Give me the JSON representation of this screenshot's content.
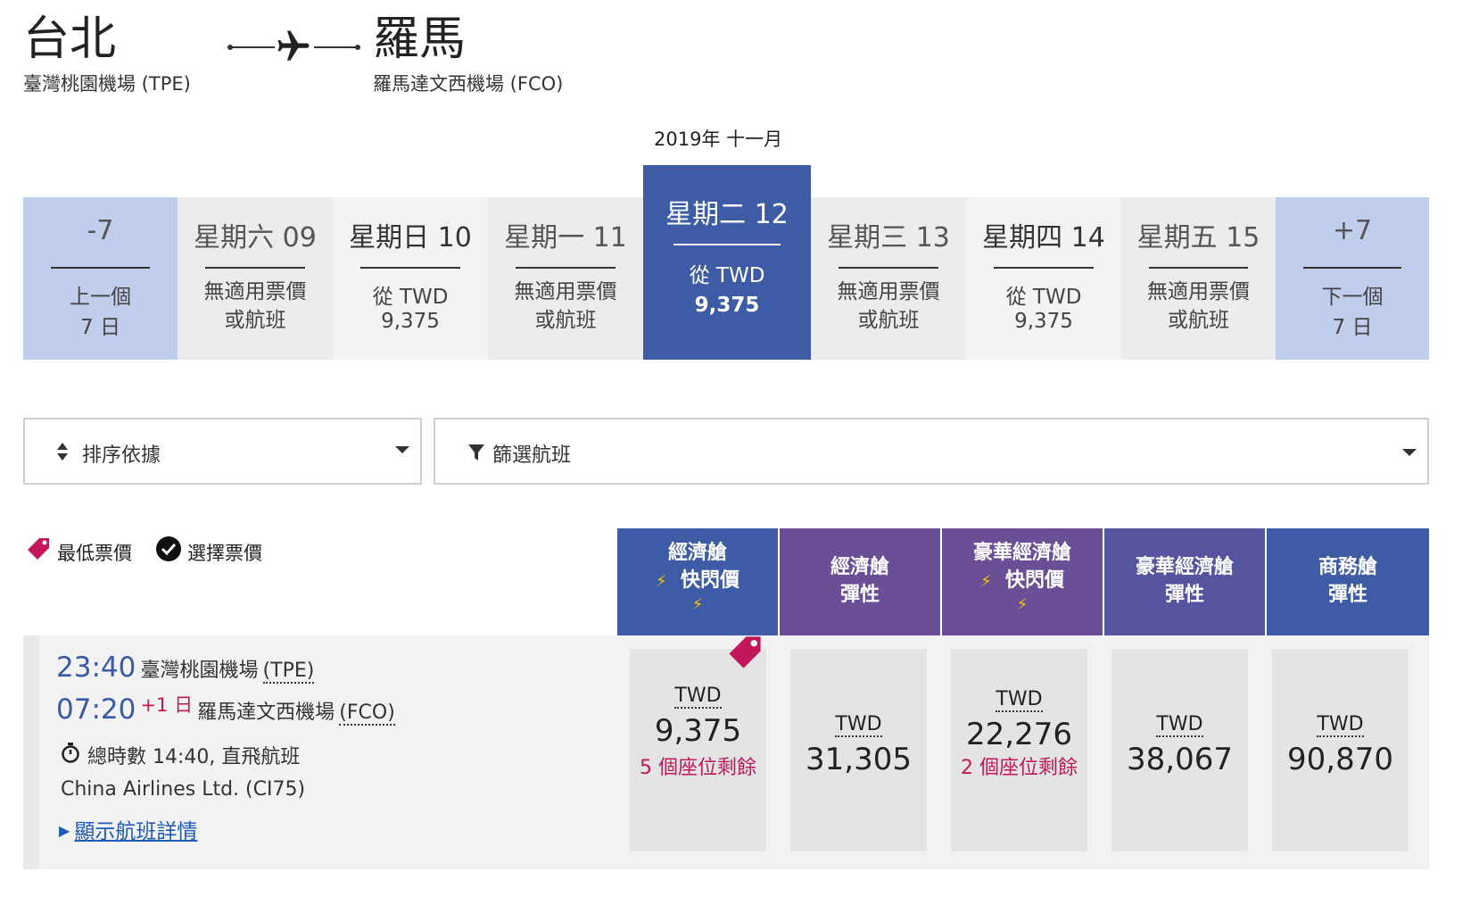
{
  "route": {
    "origin_city": "台北",
    "origin_airport": "臺灣桃園機場 (TPE)",
    "dest_city": "羅馬",
    "dest_airport": "羅馬達文西機場 (FCO)"
  },
  "month_label": "2019年 十一月",
  "date_strip": {
    "prev": {
      "top": "-7",
      "line1": "上一個",
      "line2": "7 日"
    },
    "days": [
      {
        "label": "星期六 09",
        "line1": "無適用票價",
        "line2": "或航班",
        "state": "unavailable"
      },
      {
        "label": "星期日 10",
        "line1": "從 TWD",
        "line2": "9,375",
        "state": "available"
      },
      {
        "label": "星期一 11",
        "line1": "無適用票價",
        "line2": "或航班",
        "state": "unavailable"
      },
      {
        "label": "星期二 12",
        "line1": "從 TWD",
        "line2": "9,375",
        "state": "selected"
      },
      {
        "label": "星期三 13",
        "line1": "無適用票價",
        "line2": "或航班",
        "state": "unavailable"
      },
      {
        "label": "星期四 14",
        "line1": "從 TWD",
        "line2": "9,375",
        "state": "available"
      },
      {
        "label": "星期五 15",
        "line1": "無適用票價",
        "line2": "或航班",
        "state": "unavailable"
      }
    ],
    "next": {
      "top": "+7",
      "line1": "下一個",
      "line2": "7 日"
    }
  },
  "controls": {
    "sort_label": "排序依據",
    "filter_label": "篩選航班"
  },
  "legend": {
    "lowest": "最低票價",
    "selected": "選擇票價"
  },
  "fare_classes": [
    {
      "line1": "經濟艙",
      "line2": "快閃價",
      "flash": true,
      "color": "#3e5ca6"
    },
    {
      "line1": "經濟艙",
      "line2": "彈性",
      "flash": false,
      "color": "#6b4f96"
    },
    {
      "line1": "豪華經濟艙",
      "line2": "快閃價",
      "flash": true,
      "color": "#6b4f96"
    },
    {
      "line1": "豪華經濟艙",
      "line2": "彈性",
      "flash": false,
      "color": "#56539f"
    },
    {
      "line1": "商務艙",
      "line2": "彈性",
      "flash": false,
      "color": "#3e5ca6"
    }
  ],
  "flight": {
    "depart_time": "23:40",
    "depart_airport": "臺灣桃園機場",
    "depart_code": "(TPE)",
    "arrive_time": "07:20",
    "day_offset": "+1 日",
    "arrive_airport": "羅馬達文西機場",
    "arrive_code": "(FCO)",
    "duration": "總時數 14:40, 直飛航班",
    "carrier": "China Airlines Ltd. (CI75)",
    "details_link": "顯示航班詳情",
    "fares": [
      {
        "currency": "TWD",
        "amount": "9,375",
        "seats": "5 個座位剩餘",
        "lowest": true
      },
      {
        "currency": "TWD",
        "amount": "31,305",
        "seats": "",
        "lowest": false
      },
      {
        "currency": "TWD",
        "amount": "22,276",
        "seats": "2 個座位剩餘",
        "lowest": false
      },
      {
        "currency": "TWD",
        "amount": "38,067",
        "seats": "",
        "lowest": false
      },
      {
        "currency": "TWD",
        "amount": "90,870",
        "seats": "",
        "lowest": false
      }
    ]
  },
  "colors": {
    "selected_blue": "#3e5ca6",
    "nav_light": "#c0cdeb",
    "accent_pink": "#c2185b",
    "link_blue": "#1f5bb5"
  }
}
